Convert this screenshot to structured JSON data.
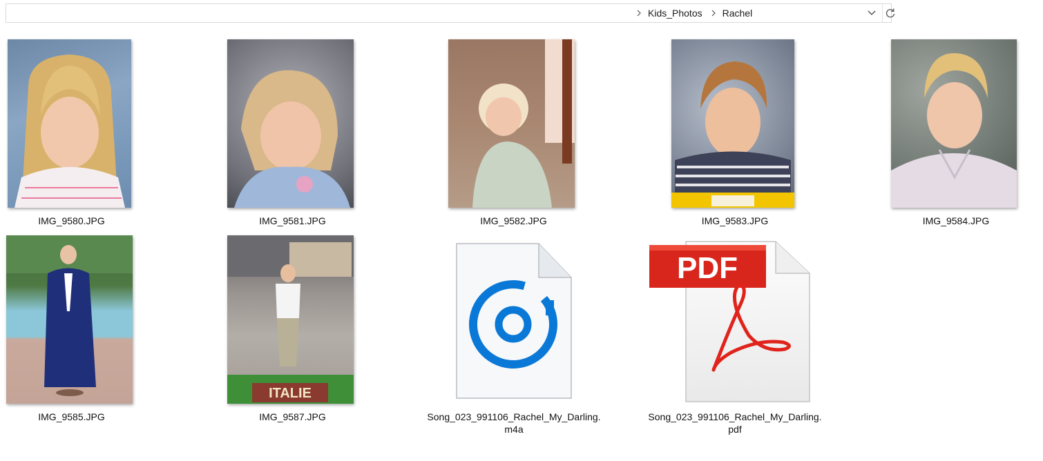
{
  "address": {
    "breadcrumbs": [
      "Kids_Photos",
      "Rachel"
    ]
  },
  "files": [
    {
      "name": "IMG_9580.JPG",
      "kind": "image"
    },
    {
      "name": "IMG_9581.JPG",
      "kind": "image"
    },
    {
      "name": "IMG_9582.JPG",
      "kind": "image"
    },
    {
      "name": "IMG_9583.JPG",
      "kind": "image"
    },
    {
      "name": "IMG_9584.JPG",
      "kind": "image"
    },
    {
      "name": "IMG_9585.JPG",
      "kind": "image"
    },
    {
      "name": "IMG_9587.JPG",
      "kind": "image"
    },
    {
      "name_line1": "Song_023_991106_Rachel_My_Darling.",
      "name_line2": "m4a",
      "kind": "audio",
      "icon": "groove-music-icon"
    },
    {
      "name_line1": "Song_023_991106_Rachel_My_Darling.",
      "name_line2": "pdf",
      "kind": "pdf",
      "icon": "pdf-icon",
      "badge": "PDF"
    }
  ],
  "photo_caption": "ITALIE",
  "colors": {
    "audio_blue": "#0a78d7",
    "pdf_red": "#d9261c",
    "caution_yellow": "#f2c500"
  }
}
